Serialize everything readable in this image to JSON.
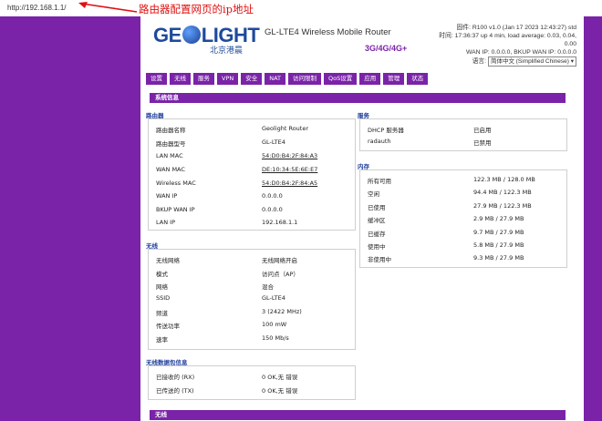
{
  "browser": {
    "url": "http://192.168.1.1/"
  },
  "annotation": {
    "text": "路由器配置网页的ip地址"
  },
  "header": {
    "logo": "GE LIGHT",
    "logo_left": "GE",
    "logo_right": "LIGHT",
    "logo_sub": "北京港晨",
    "product": "GL-LTE4 Wireless Mobile Router",
    "subproduct": "3G/4G/4G+",
    "status_lines": [
      "固件: R100 v1.0 (Jan 17 2023 12:43:27) std",
      "时间: 17:36:37 up 4 min, load average: 0.03, 0.04,",
      "0.00",
      "WAN IP: 0.0.0.0, BKUP WAN IP: 0.0.0.0"
    ],
    "lang_label": "语言:",
    "lang_value": "简体中文 (Simplified Chinese)"
  },
  "nav": [
    "设置",
    "无线",
    "服务",
    "VPN",
    "安全",
    "NAT",
    "访问限制",
    "QoS设置",
    "应用",
    "管理",
    "状态"
  ],
  "page_title": "系统信息",
  "router": {
    "title": "路由器",
    "rows": [
      {
        "label": "路由器名称",
        "value": "Geolight Router"
      },
      {
        "label": "路由器型号",
        "value": "GL-LTE4"
      },
      {
        "label": "LAN MAC",
        "value": "54:D0:B4:2F:84:A3"
      },
      {
        "label": "WAN MAC",
        "value": "DE:10:34:5E:6E:E7"
      },
      {
        "label": "Wireless MAC",
        "value": "54:D0:B4:2F:84:A5"
      },
      {
        "label": "WAN IP",
        "value": "0.0.0.0"
      },
      {
        "label": "BKUP WAN IP",
        "value": "0.0.0.0"
      },
      {
        "label": "LAN IP",
        "value": "192.168.1.1"
      }
    ]
  },
  "services": {
    "title": "服务",
    "rows": [
      {
        "label": "DHCP 服务器",
        "value": "已启用"
      },
      {
        "label": "radauth",
        "value": "已禁用"
      }
    ]
  },
  "memory": {
    "title": "内存",
    "rows": [
      {
        "label": "所有可用",
        "value": "122.3 MB / 128.0 MB"
      },
      {
        "label": "空闲",
        "value": "94.4 MB / 122.3 MB"
      },
      {
        "label": "已使用",
        "value": "27.9 MB / 122.3 MB"
      },
      {
        "label": "缓冲区",
        "value": "2.9 MB / 27.9 MB"
      },
      {
        "label": "已缓存",
        "value": "9.7 MB / 27.9 MB"
      },
      {
        "label": "使用中",
        "value": "5.8 MB / 27.9 MB"
      },
      {
        "label": "非使用中",
        "value": "9.3 MB / 27.9 MB"
      }
    ]
  },
  "wireless": {
    "title": "无线",
    "rows": [
      {
        "label": "无线网络",
        "value": "无线网络开启"
      },
      {
        "label": "模式",
        "value": "访问点（AP）"
      },
      {
        "label": "网络",
        "value": "混合"
      },
      {
        "label": "SSID",
        "value": "GL-LTE4"
      },
      {
        "label": "频道",
        "value": "3 (2422 MHz)"
      },
      {
        "label": "传送功率",
        "value": "100 mW"
      },
      {
        "label": "速率",
        "value": "150 Mb/s"
      }
    ]
  },
  "packets": {
    "title": "无线数据包信息",
    "rows": [
      {
        "label": "已接收的 (RX)",
        "value": "0 OK,无 错误"
      },
      {
        "label": "已传送的 (TX)",
        "value": "0 OK,无 错误"
      }
    ]
  },
  "footer_bar": "无线"
}
